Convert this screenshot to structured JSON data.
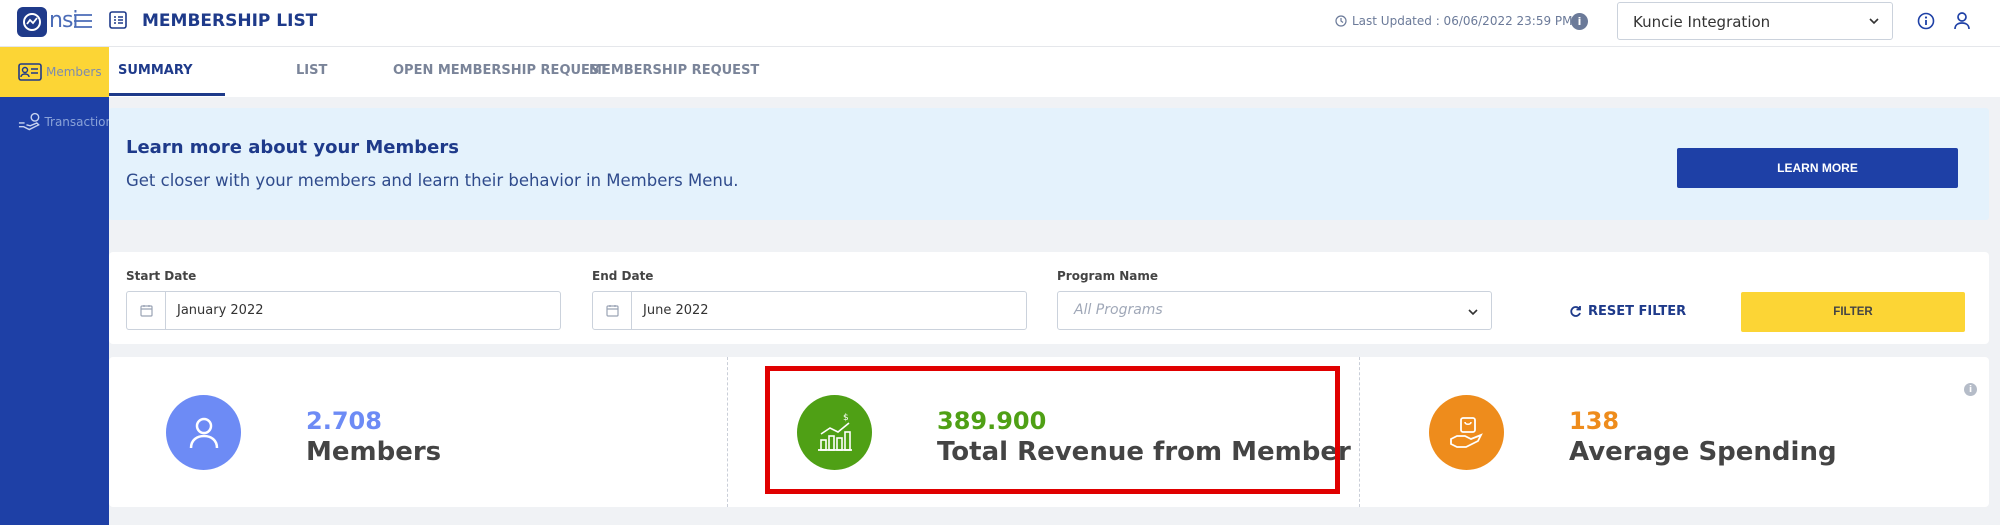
{
  "header": {
    "logo_text": "nsi",
    "title": "MEMBERSHIP LIST",
    "last_updated": "Last Updated : 06/06/2022 23:59 PM",
    "company_select": "Kuncie Integration"
  },
  "sidebar": {
    "items": [
      {
        "label": "Members",
        "active": true,
        "icon": "member-card-icon"
      },
      {
        "label": "Transaction",
        "active": false,
        "icon": "hand-money-icon"
      }
    ]
  },
  "tabs": [
    {
      "label": "SUMMARY",
      "active": true
    },
    {
      "label": "LIST",
      "active": false
    },
    {
      "label": "OPEN MEMBERSHIP REQUEST",
      "active": false
    },
    {
      "label": "MEMBERSHIP REQUEST",
      "active": false
    }
  ],
  "banner": {
    "title": "Learn more about your Members",
    "subtitle": "Get closer with your members and learn their behavior in Members Menu.",
    "button": "LEARN MORE"
  },
  "filters": {
    "start_date": {
      "label": "Start Date",
      "value": "January 2022"
    },
    "end_date": {
      "label": "End Date",
      "value": "June 2022"
    },
    "program": {
      "label": "Program Name",
      "placeholder": "All Programs"
    },
    "reset_label": "RESET FILTER",
    "filter_label": "FILTER"
  },
  "stats": [
    {
      "value": "2.708",
      "label": "Members",
      "color": "#6d8bf5",
      "icon": "user-icon"
    },
    {
      "value": "389.900",
      "label": "Total Revenue from Member",
      "color": "#4fa015",
      "icon": "revenue-chart-icon"
    },
    {
      "value": "138",
      "label": "Average Spending",
      "color": "#ee8c1c",
      "icon": "shopping-bag-hand-icon"
    }
  ],
  "colors": {
    "primary": "#1e40a6",
    "accent_yellow": "#fcd535",
    "highlight_red": "#e00000"
  }
}
